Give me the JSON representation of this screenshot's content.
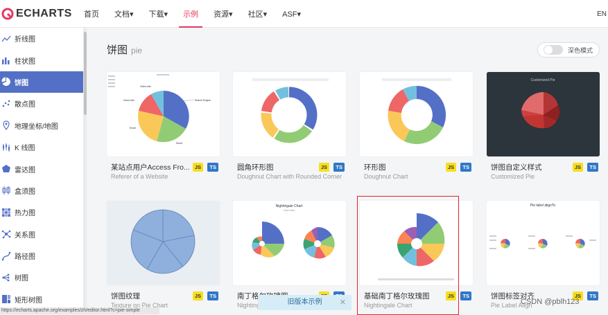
{
  "header": {
    "logo_text": "ECHARTS",
    "nav": [
      "首页",
      "文档▾",
      "下载▾",
      "示例",
      "资源▾",
      "社区▾",
      "ASF▾"
    ],
    "lang": "EN"
  },
  "sidebar": {
    "items": [
      {
        "label": "折线图",
        "icon": "line-chart-icon"
      },
      {
        "label": "柱状图",
        "icon": "bar-chart-icon"
      },
      {
        "label": "饼图",
        "icon": "pie-chart-icon",
        "active": true
      },
      {
        "label": "散点图",
        "icon": "scatter-chart-icon"
      },
      {
        "label": "地理坐标/地图",
        "icon": "map-icon"
      },
      {
        "label": "K 线图",
        "icon": "candlestick-icon"
      },
      {
        "label": "雷达图",
        "icon": "radar-icon"
      },
      {
        "label": "盒须图",
        "icon": "boxplot-icon"
      },
      {
        "label": "热力图",
        "icon": "heatmap-icon"
      },
      {
        "label": "关系图",
        "icon": "graph-icon"
      },
      {
        "label": "路径图",
        "icon": "lines-icon"
      },
      {
        "label": "树图",
        "icon": "tree-icon"
      },
      {
        "label": "矩形树图",
        "icon": "treemap-icon"
      }
    ]
  },
  "section": {
    "title": "饼图",
    "subtitle": "pie"
  },
  "dark_mode": {
    "label": "深色模式"
  },
  "badges": {
    "js": "JS",
    "ts": "TS"
  },
  "cards": [
    {
      "title": "某站点用户Access Fro...",
      "subtitle": "Referer of a Website"
    },
    {
      "title": "圆角环形图",
      "subtitle": "Doughnut Chart with Rounded Corner"
    },
    {
      "title": "环形图",
      "subtitle": "Doughnut Chart"
    },
    {
      "title": "饼图自定义样式",
      "subtitle": "Customized Pie"
    },
    {
      "title": "饼图纹理",
      "subtitle": "Texture on Pie Chart"
    },
    {
      "title": "南丁格尔玫瑰图",
      "subtitle": "Nightingale Chart"
    },
    {
      "title": "基础南丁格尔玫瑰图",
      "subtitle": "Nightingale Chart"
    },
    {
      "title": "饼图标签对齐",
      "subtitle": "Pie Label Align"
    }
  ],
  "thumb_text": {
    "card1_labels": [
      "Search Engine",
      "Direct",
      "Email",
      "Union Ads",
      "Video Ads"
    ],
    "card3_title": "Customized Pie",
    "card5_title": "Nightingale Chart",
    "card5_sub": "Fake Data",
    "card7_title": "Pie label alignTo"
  },
  "colors": {
    "accent": "#e43961",
    "sidebar_active": "#5470c6",
    "palette": [
      "#5470c6",
      "#91cc75",
      "#fac858",
      "#ee6666",
      "#73c0de",
      "#3ba272",
      "#fc8452",
      "#9a60b4",
      "#ea7ccc"
    ]
  },
  "footer": {
    "status_url": "https://echarts.apache.org/examples/zh/editor.html?c=pie-simple",
    "old_version": "旧版本示例",
    "watermark": "CSDN @pblh123"
  }
}
